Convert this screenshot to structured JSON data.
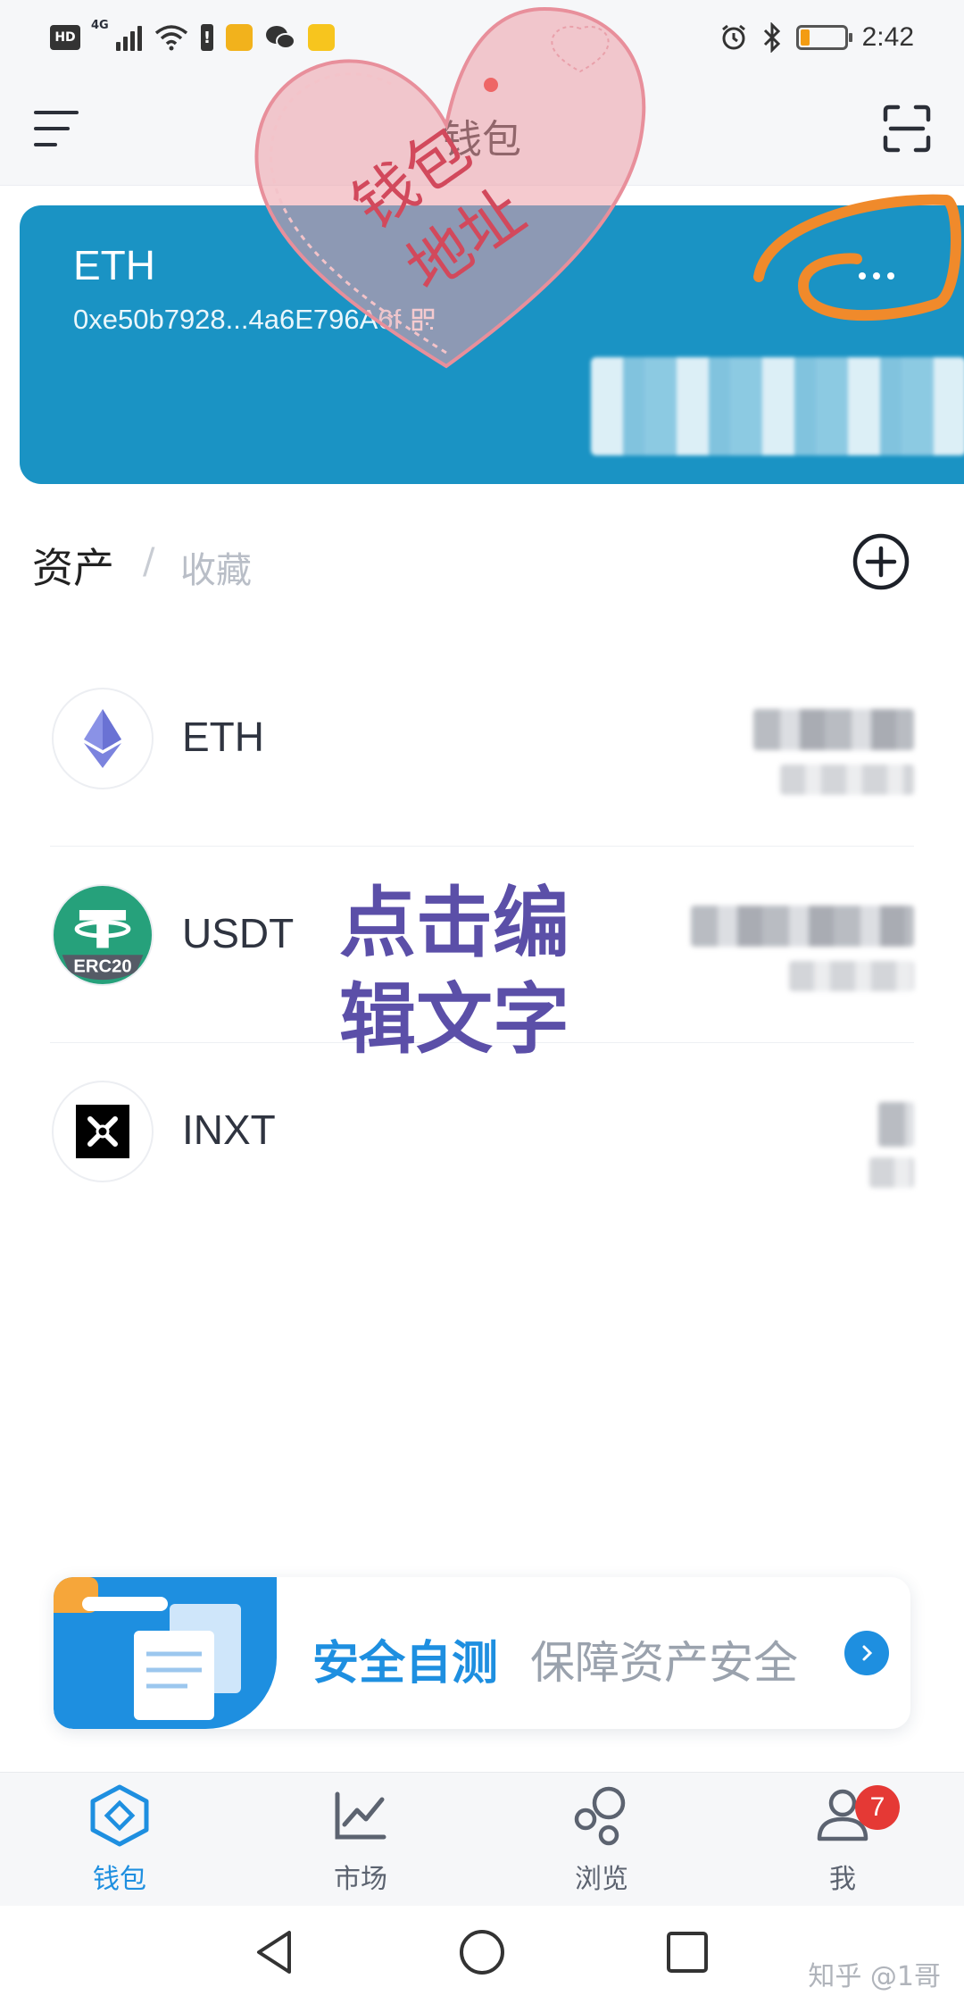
{
  "status_bar": {
    "network": "4G",
    "time": "2:42",
    "battery_level": 0.2
  },
  "header": {
    "title": "钱包"
  },
  "wallet": {
    "name": "ETH",
    "address": "0xe50b7928...4a6E796A6f",
    "card_color": "#1a93c4"
  },
  "stamps": {
    "heart_line1": "钱包",
    "heart_line2": "地址",
    "overlay_line1": "点击编",
    "overlay_line2": "辑文字"
  },
  "tabs": {
    "assets": "资产",
    "separator": "/",
    "favorites": "收藏"
  },
  "assets": [
    {
      "symbol": "ETH",
      "icon": "ethereum-icon"
    },
    {
      "symbol": "USDT",
      "icon": "tether-icon",
      "tag": "ERC20"
    },
    {
      "symbol": "INXT",
      "icon": "inxt-icon"
    }
  ],
  "banner": {
    "title": "安全自测",
    "subtitle": "保障资产安全"
  },
  "bottom_nav": {
    "wallet": "钱包",
    "market": "市场",
    "browse": "浏览",
    "me": "我",
    "me_badge": "7"
  },
  "watermark": "知乎 @1哥",
  "colors": {
    "accent": "#1e8fe0",
    "badge": "#e53935",
    "overlay_purple": "#5b4fa8",
    "annotation_orange": "#f08a2b"
  }
}
